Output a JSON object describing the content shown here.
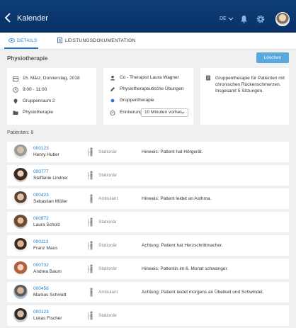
{
  "topbar": {
    "title": "Kalender",
    "language": "DE"
  },
  "tabs": [
    {
      "label": "DETAILS"
    },
    {
      "label": "LEISTUNGSDOKUMENTATION"
    }
  ],
  "page": {
    "title": "Physiotherapie",
    "delete_label": "Löschen"
  },
  "card1": {
    "date": "15. März, Donnerstag, 2018",
    "time": "9:00 - 11:00",
    "room": "Gruppenraum 2",
    "category": "Physiotherapie"
  },
  "card2": {
    "therapist": "Co - Therapist Laura Wagner",
    "exercise": "Physiotherapeutische Übungen",
    "group": "Gruppentherapie",
    "reminder_label": "Erinnerung",
    "reminder_value": "10 Minuten vorher",
    "group_dot_color": "#2b7bd6"
  },
  "card3": {
    "description": "Gruppentherapie für Patienten mit chronischen Rückenschmerzen. Insgesamt 5 Sitzungen."
  },
  "patients_label": "Patienten: 8",
  "patients": [
    {
      "id": "000123",
      "name": "Henry Huber",
      "type": "Stationär",
      "note": "Hinweis: Patient hat Hörgerät."
    },
    {
      "id": "000777",
      "name": "Steffanie Lindner",
      "type": "Stationär",
      "note": ""
    },
    {
      "id": "000423",
      "name": "Sebastian Müller",
      "type": "Ambulant",
      "note": "Hinweis: Patient leidet an Asthma."
    },
    {
      "id": "000872",
      "name": "Laura Scholz",
      "type": "Stationär",
      "note": ""
    },
    {
      "id": "000113",
      "name": "Franz Maus",
      "type": "Stationär",
      "note": "Achtung: Patient hat Herzschrittmacher."
    },
    {
      "id": "000732",
      "name": "Andrea Baum",
      "type": "Stationär",
      "note": "Hinweis: Patientin im 6. Monat schwanger."
    },
    {
      "id": "000456",
      "name": "Markus Schmidt",
      "type": "Ambulant",
      "note": "Achtung: Patient leidet morgens an Übelkeit und Schwindel."
    },
    {
      "id": "000123",
      "name": "Lukas Fischer",
      "type": "Stationär",
      "note": ""
    }
  ]
}
